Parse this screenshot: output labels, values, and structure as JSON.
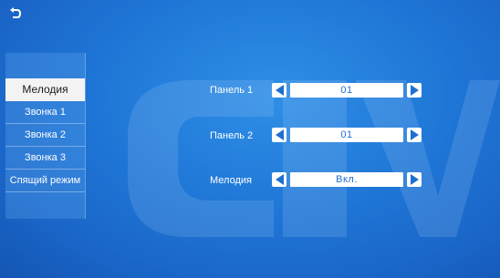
{
  "header": {
    "back_icon": "return-arrow-icon"
  },
  "sidebar": {
    "items": [
      {
        "label": "Мелодия",
        "active": true
      },
      {
        "label": "Звонка 1",
        "active": false
      },
      {
        "label": "Звонка 2",
        "active": false
      },
      {
        "label": "Звонка 3",
        "active": false
      },
      {
        "label": "Спящий режим",
        "active": false
      }
    ]
  },
  "settings": {
    "rows": [
      {
        "label": "Панель 1",
        "value": "01"
      },
      {
        "label": "Панель 2",
        "value": "01"
      },
      {
        "label": "Мелодия",
        "value": "Вкл."
      }
    ]
  },
  "colors": {
    "background": "#1f76d6",
    "accent": "#1f6fd0",
    "active_item": "#f3f3f3"
  }
}
